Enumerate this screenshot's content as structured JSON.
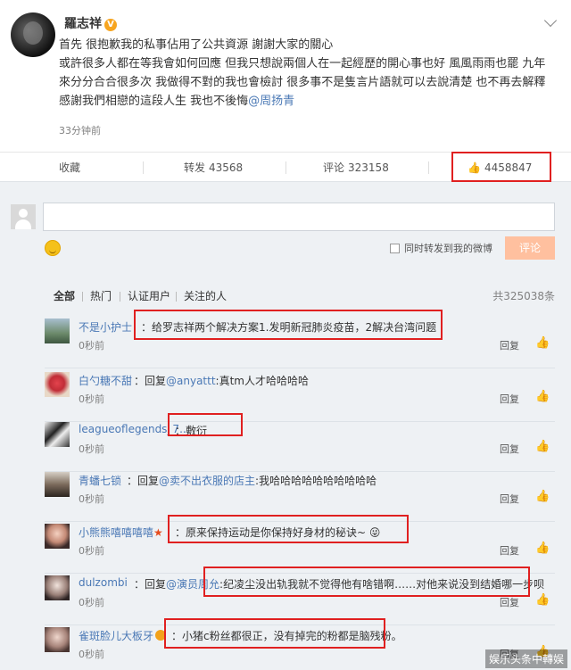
{
  "post": {
    "author": "羅志祥",
    "verified_badge": "V",
    "lines": [
      "首先 很抱歉我的私事佔用了公共資源 謝謝大家的關心",
      "或許很多人都在等我會如何回應 但我只想說兩個人在一起經歷的開心事也好 風風雨雨也罷 九年",
      "來分分合合很多次 我做得不對的我也會檢討 很多事不是隻言片語就可以去說清楚 也不再去解釋",
      "感謝我們相戀的這段人生 我也不後悔"
    ],
    "mention": "@周扬青",
    "time": "33分钟前"
  },
  "actions": {
    "favorite": "收藏",
    "repost_label": "转发",
    "repost_count": "43568",
    "comment_label": "评论",
    "comment_count": "323158",
    "like_count": "4458847"
  },
  "compose": {
    "also_repost_label": "同时转发到我的微博",
    "submit_label": "评论"
  },
  "filters": {
    "tabs": [
      "全部",
      "热门",
      "认证用户",
      "关注的人"
    ],
    "total": "共325038条"
  },
  "comments": [
    {
      "name": "不是小护士",
      "prefix": "",
      "mention": "",
      "text": "：给罗志祥两个解决方案1.发明新冠肺炎疫苗，2解决台湾问题",
      "time": "0秒前",
      "reply": "回复"
    },
    {
      "name": "白勺糖不甜",
      "prefix": "：回复",
      "mention": "@anyattt",
      "text": ":真tm人才哈哈哈哈",
      "time": "0秒前",
      "reply": "回复"
    },
    {
      "name": "leagueoflegends_7...",
      "prefix": "",
      "mention": "",
      "text": "：敷衍",
      "time": "0秒前",
      "reply": "回复"
    },
    {
      "name": "青蟠七锁",
      "prefix": "：回复",
      "mention": "@卖不出衣服的店主",
      "text": ":我哈哈哈哈哈哈哈哈哈哈",
      "time": "0秒前",
      "reply": "回复"
    },
    {
      "name": "小熊熊嘻嘻嘻嘻",
      "prefix": "",
      "mention": "",
      "text": "：原来保持运动是你保持好身材的秘诀~",
      "time": "0秒前",
      "reply": "回复"
    },
    {
      "name": "dulzombi",
      "prefix": "：回复",
      "mention": "@演员周允",
      "text": ":纪凌尘没出轨我就不觉得他有啥错啊……对他来说没到结婚哪一步呗",
      "time": "0秒前",
      "reply": "回复"
    },
    {
      "name": "雀斑脸儿大板牙",
      "prefix": "",
      "mention": "",
      "text": "：小猪c粉丝都很正，没有掉完的粉都是脑残粉。",
      "time": "0秒前",
      "reply": "回复"
    }
  ],
  "watermark": "娱乐头条中轉娱",
  "colors": {
    "highlight_box": "#e02020",
    "link": "#4a78b5",
    "submit_bg": "#ffc09f"
  },
  "icons": [
    "chevron-down-icon",
    "thumbs-up-icon",
    "emoji-icon",
    "user-placeholder-icon",
    "vip-star-icon",
    "medal-icon"
  ]
}
